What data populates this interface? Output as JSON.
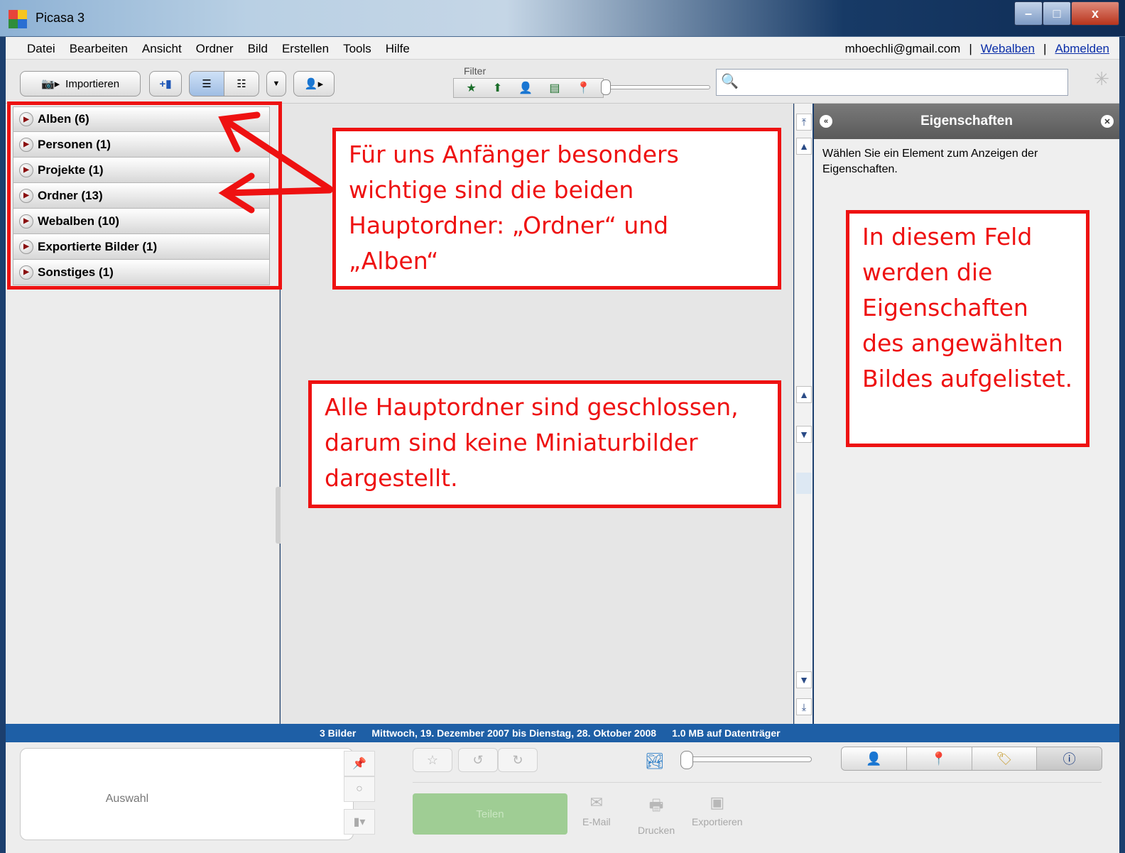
{
  "window": {
    "title": "Picasa 3"
  },
  "menu": {
    "items": [
      "Datei",
      "Bearbeiten",
      "Ansicht",
      "Ordner",
      "Bild",
      "Erstellen",
      "Tools",
      "Hilfe"
    ],
    "account_email": "mhoechli@gmail.com",
    "separator": "|",
    "webalbums_link": "Webalben",
    "logout_link": "Abmelden"
  },
  "toolbar": {
    "import_label": "Importieren",
    "filter_label": "Filter",
    "search_value": ""
  },
  "sidebar": {
    "items": [
      {
        "label": "Alben (6)"
      },
      {
        "label": "Personen (1)"
      },
      {
        "label": "Projekte (1)"
      },
      {
        "label": "Ordner (13)"
      },
      {
        "label": "Webalben (10)"
      },
      {
        "label": "Exportierte Bilder (1)"
      },
      {
        "label": "Sonstiges (1)"
      }
    ]
  },
  "properties": {
    "title": "Eigenschaften",
    "message": "Wählen Sie ein Element zum Anzeigen der Eigenschaften."
  },
  "status": {
    "count": "3 Bilder",
    "date_range": "Mittwoch, 19. Dezember 2007 bis Dienstag, 28. Oktober 2008",
    "disk": "1.0 MB auf Datenträger"
  },
  "tray": {
    "selection_label": "Auswahl",
    "share_label": "Teilen",
    "email_label": "E-Mail",
    "print_label": "Drucken",
    "export_label": "Exportieren"
  },
  "annotations": {
    "callout_main_folders": "Für uns Anfänger besonders wichtige sind die beiden Hauptordner: „Ordner“ und „Alben“",
    "callout_closed": "Alle Hauptordner sind geschlossen, darum sind keine Miniaturbilder dargestellt.",
    "callout_properties": "In diesem Feld werden die Eigenschaften des angewählten Bildes aufgelistet."
  },
  "colors": {
    "annotation": "#ee1111",
    "statusbar": "#1e5fa6",
    "titlebar_dark": "#173a66"
  }
}
